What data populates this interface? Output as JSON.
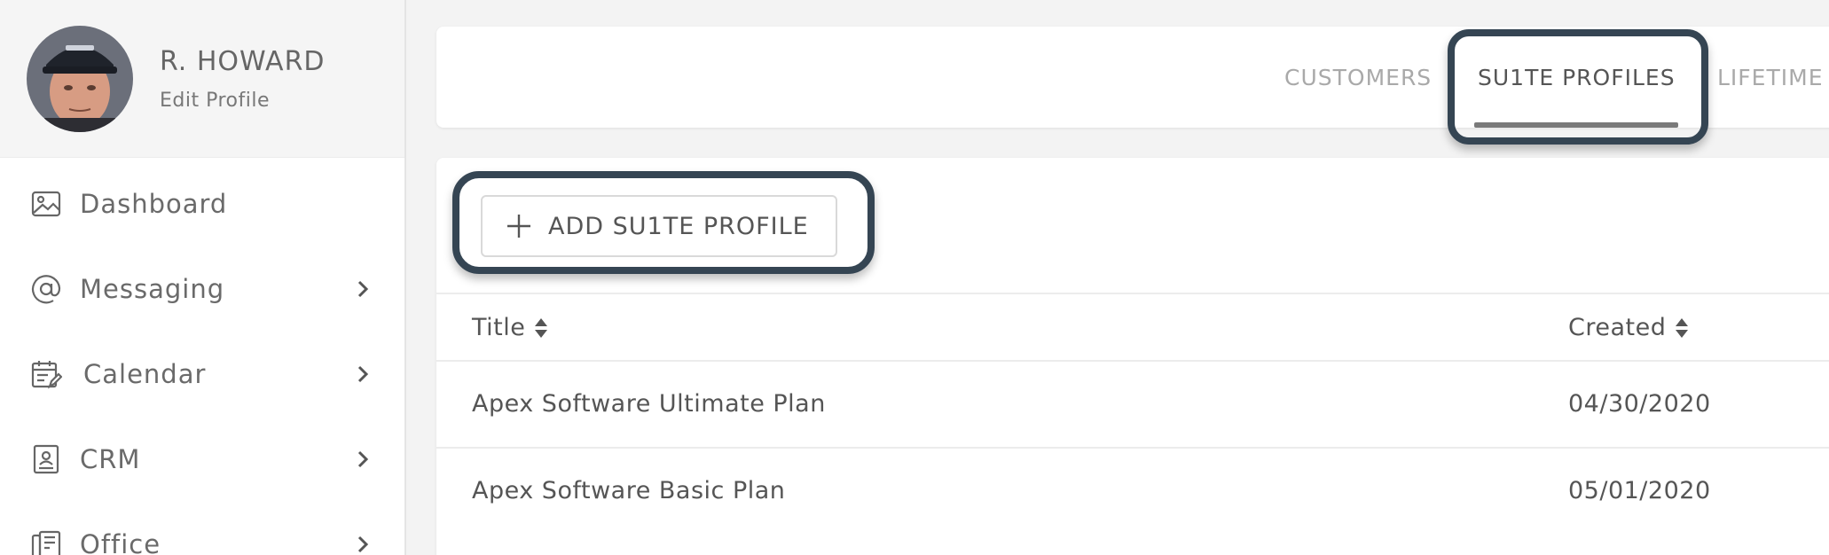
{
  "user": {
    "name": "R. HOWARD",
    "edit_profile_label": "Edit Profile"
  },
  "sidebar": {
    "items": [
      {
        "label": "Dashboard",
        "icon": "image-icon",
        "has_submenu": false
      },
      {
        "label": "Messaging",
        "icon": "at-icon",
        "has_submenu": true
      },
      {
        "label": "Calendar",
        "icon": "calendar-edit-icon",
        "has_submenu": true
      },
      {
        "label": "CRM",
        "icon": "contact-card-icon",
        "has_submenu": true
      },
      {
        "label": "Office",
        "icon": "office-phone-icon",
        "has_submenu": true
      }
    ]
  },
  "tabs": [
    {
      "label": "CUSTOMERS",
      "active": false
    },
    {
      "label": "SU1TE PROFILES",
      "active": true
    },
    {
      "label": "LIFETIME",
      "active": false
    }
  ],
  "toolbar": {
    "add_label": "ADD SU1TE PROFILE"
  },
  "table": {
    "columns": [
      "Title",
      "Created"
    ],
    "rows": [
      {
        "title": "Apex Software Ultimate Plan",
        "created": "04/30/2020"
      },
      {
        "title": "Apex Software Basic Plan",
        "created": "05/01/2020"
      }
    ]
  },
  "colors": {
    "highlight_border": "#354553",
    "tab_underline": "#7a7a7a",
    "inactive_tab": "#a9a9a9"
  }
}
